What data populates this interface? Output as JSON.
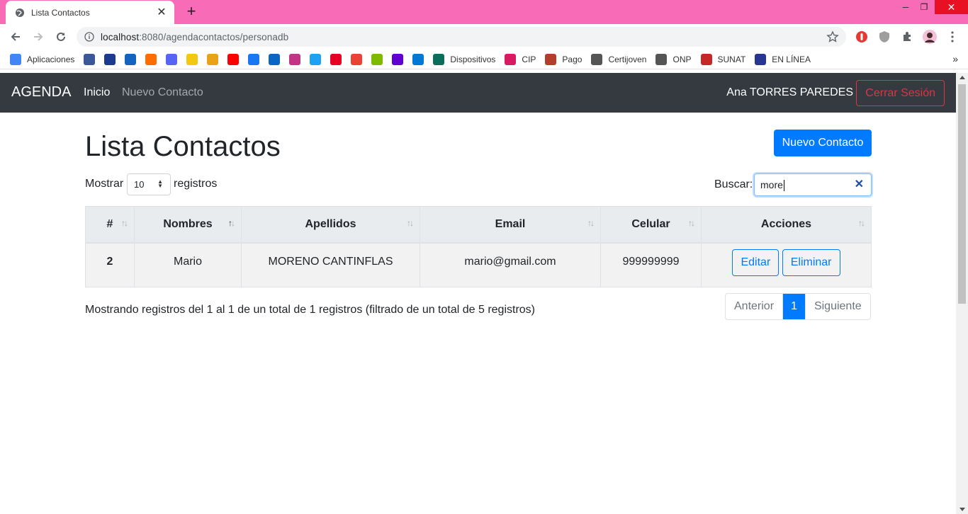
{
  "browser": {
    "tab_title": "Lista Contactos",
    "url_host": "localhost",
    "url_path": ":8080/agendacontactos/personadb",
    "bookmarks": [
      {
        "label": "Aplicaciones",
        "color": "#4285f4"
      },
      {
        "label": "",
        "color": "#3b5998"
      },
      {
        "label": "",
        "color": "#1a3b8e"
      },
      {
        "label": "",
        "color": "#1565c0"
      },
      {
        "label": "",
        "color": "#ff6d00"
      },
      {
        "label": "",
        "color": "#5865f2"
      },
      {
        "label": "",
        "color": "#f2c811"
      },
      {
        "label": "",
        "color": "#e8a317"
      },
      {
        "label": "",
        "color": "#ff0000"
      },
      {
        "label": "",
        "color": "#1877f2"
      },
      {
        "label": "",
        "color": "#0a66c2"
      },
      {
        "label": "",
        "color": "#c13584"
      },
      {
        "label": "",
        "color": "#1da1f2"
      },
      {
        "label": "",
        "color": "#e60023"
      },
      {
        "label": "",
        "color": "#ea4335"
      },
      {
        "label": "",
        "color": "#7fba00"
      },
      {
        "label": "",
        "color": "#6001d2"
      },
      {
        "label": "",
        "color": "#0078d4"
      },
      {
        "label": "Dispositivos",
        "color": "#0b6e5a"
      },
      {
        "label": "CIP",
        "color": "#d81b60"
      },
      {
        "label": "Pago",
        "color": "#b33f2b"
      },
      {
        "label": "Certijoven",
        "color": "#555555"
      },
      {
        "label": "ONP",
        "color": "#555555"
      },
      {
        "label": "SUNAT",
        "color": "#c62828"
      },
      {
        "label": "EN LÍNEA",
        "color": "#283593"
      }
    ]
  },
  "navbar": {
    "brand": "AGENDA",
    "links": [
      "Inicio",
      "Nuevo Contacto"
    ],
    "user": "Ana TORRES PAREDES",
    "logout": "Cerrar Sesión"
  },
  "main": {
    "title": "Lista Contactos",
    "new_button": "Nuevo Contacto",
    "length_prefix": "Mostrar",
    "length_value": "10",
    "length_suffix": "registros",
    "search_label": "Buscar:",
    "search_value": "more"
  },
  "table": {
    "headers": [
      "#",
      "Nombres",
      "Apellidos",
      "Email",
      "Celular",
      "Acciones"
    ],
    "rows": [
      {
        "id": "2",
        "nombres": "Mario",
        "apellidos": "MORENO CANTINFLAS",
        "email": "mario@gmail.com",
        "celular": "999999999",
        "edit": "Editar",
        "delete": "Eliminar"
      }
    ]
  },
  "footer": {
    "info": "Mostrando registros del 1 al 1 de un total de 1 registros (filtrado de un total de 5 registros)",
    "prev": "Anterior",
    "page": "1",
    "next": "Siguiente"
  },
  "colors": {
    "tab_strip": "#f86bb7",
    "navbar": "#343a40",
    "primary": "#007bff",
    "danger": "#dc3545"
  }
}
